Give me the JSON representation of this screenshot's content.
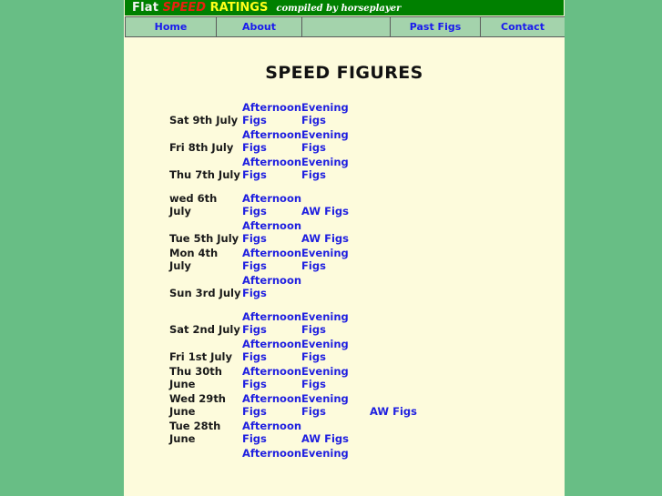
{
  "masthead": {
    "word1": "Flat",
    "word2": "SPEED",
    "word3": "RATINGS",
    "subtitle": "compiled by horseplayer",
    "colors": {
      "background": "#008000",
      "flat": "#f2f2f2",
      "speed": "#e8210f",
      "ratings": "#ffff1a",
      "subtitle": "#ffffff"
    }
  },
  "nav": {
    "items": [
      {
        "label": "Home",
        "name": "nav-home"
      },
      {
        "label": "About",
        "name": "nav-about"
      },
      {
        "label": "",
        "name": "nav-empty"
      },
      {
        "label": "Past Figs",
        "name": "nav-past-figs"
      },
      {
        "label": "Contact",
        "name": "nav-contact"
      }
    ],
    "background": "#a4d3ac",
    "link_color": "#1a1aee"
  },
  "page": {
    "title": "SPEED FIGURES",
    "background": "#fdfbdc",
    "outer_background": "#68be85"
  },
  "labels": {
    "afternoon": "Afternoon Figs",
    "evening": "Evening Figs",
    "aw": "AW Figs"
  },
  "figures": {
    "link_color": "#1f1fe0",
    "rows": [
      {
        "date": "Sat 9th July",
        "afternoon": "Afternoon Figs",
        "evening": "Evening Figs",
        "aw": ""
      },
      {
        "date": "Fri 8th July",
        "afternoon": "Afternoon Figs",
        "evening": "Evening Figs",
        "aw": ""
      },
      {
        "date": "Thu 7th July",
        "afternoon": "Afternoon Figs",
        "evening": "Evening Figs",
        "aw": ""
      },
      {
        "date": "wed 6th July",
        "afternoon": "Afternoon Figs",
        "evening": "AW Figs",
        "aw": ""
      },
      {
        "date": "Tue 5th July",
        "afternoon": "Afternoon Figs",
        "evening": "AW Figs",
        "aw": ""
      },
      {
        "date": "Mon 4th July",
        "afternoon": "Afternoon Figs",
        "evening": "Evening Figs",
        "aw": ""
      },
      {
        "date": "Sun 3rd July",
        "afternoon": "Afternoon Figs",
        "evening": "",
        "aw": ""
      },
      {
        "date": "Sat 2nd July",
        "afternoon": "Afternoon Figs",
        "evening": "Evening Figs",
        "aw": ""
      },
      {
        "date": "Fri 1st July",
        "afternoon": "Afternoon Figs",
        "evening": "Evening Figs",
        "aw": ""
      },
      {
        "date": "Thu 30th June",
        "afternoon": "Afternoon Figs",
        "evening": "Evening Figs",
        "aw": ""
      },
      {
        "date": "Wed 29th June",
        "afternoon": "Afternoon Figs",
        "evening": "Evening Figs",
        "aw": "AW Figs"
      },
      {
        "date": "Tue 28th June",
        "afternoon": "Afternoon Figs",
        "evening": "AW Figs",
        "aw": ""
      },
      {
        "date": "",
        "afternoon": "Afternoon",
        "evening": "Evening",
        "aw": ""
      }
    ]
  }
}
